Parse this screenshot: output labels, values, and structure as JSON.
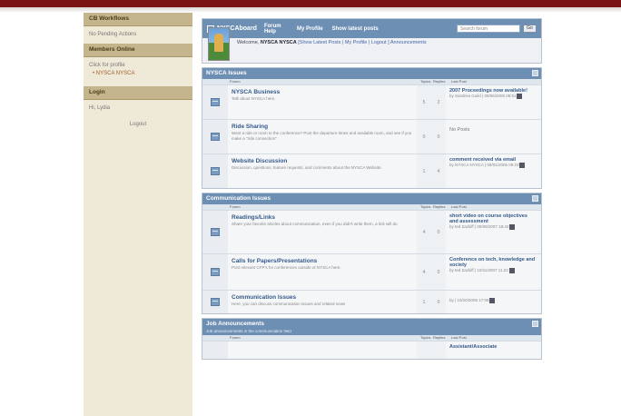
{
  "sidebar": {
    "workflows": {
      "title": "CB Workflows",
      "text": "No Pending Actions"
    },
    "members": {
      "title": "Members Online",
      "text": "Click for profile",
      "member": "NYSCA NYSCA"
    },
    "login": {
      "title": "Login",
      "text": "Hi, Lydia",
      "logout": "Logout"
    }
  },
  "header": {
    "brand": "NYSCAboard",
    "nav": [
      "Forum Help",
      "My Profile",
      "Show latest posts"
    ],
    "search_placeholder": "Search forum",
    "search_button": "Go",
    "welcome_prefix": "Welcome,",
    "welcome_user": "NYSCA NYSCA",
    "welcome_links": "[Show Latest Posts | My Profile | Logout ] Announcements"
  },
  "columns": {
    "forum": "Forum",
    "topics": "Topics",
    "posts": "Replies",
    "last": "Last Post"
  },
  "sections": [
    {
      "title": "NYSCA Issues",
      "forums": [
        {
          "name": "NYSCA Business",
          "desc": "Talk about NYSCA here.",
          "topics": "5",
          "posts": "2",
          "last_title": "2007 Proceedings now available!",
          "last_meta": "by Sandrea Guild | 09/06/2006 09:51"
        },
        {
          "name": "Ride Sharing",
          "desc": "Want a ride or room to the conference? Post the departure times and available room, and see if you make a \"ride connection\"",
          "topics": "0",
          "posts": "0",
          "last_title": "",
          "last_meta": "No Posts"
        },
        {
          "name": "Website Discussion",
          "desc": "Discussion, questions, feature requests, and comments about the NYSCA Website.",
          "topics": "1",
          "posts": "4",
          "last_title": "comment received via email",
          "last_meta": "by NYSCA NYSCA | 09/01/2006 09:23"
        }
      ]
    },
    {
      "title": "Communication Issues",
      "forums": [
        {
          "name": "Readings/Links",
          "desc": "Share your favorite articles about communication, even if you didn't write them, a link will do",
          "topics": "4",
          "posts": "0",
          "last_title": "short video on course objectives and assessment",
          "last_meta": "by ted Zackiff | 09/08/2007 18:42"
        },
        {
          "name": "Calls for Papers/Presentations",
          "desc": "Post relevant CFP's for conferences outside of NYSCA here.",
          "topics": "4",
          "posts": "0",
          "last_title": "Conference on tech, knowledge and society",
          "last_meta": "by ted Zackiff | 10/11/2007 11:23"
        },
        {
          "name": "Communication Issues",
          "desc": "Here, you can discuss communication issues and related news",
          "topics": "1",
          "posts": "0",
          "last_title": "",
          "last_meta": "by | 10/20/2006 17:06"
        }
      ]
    },
    {
      "title": "Job Announcements",
      "desc": "Job announcements in the communication field",
      "forums": [
        {
          "name": "",
          "desc": "",
          "topics": "",
          "posts": "",
          "last_title": "Assistant/Associate",
          "last_meta": ""
        }
      ]
    }
  ]
}
